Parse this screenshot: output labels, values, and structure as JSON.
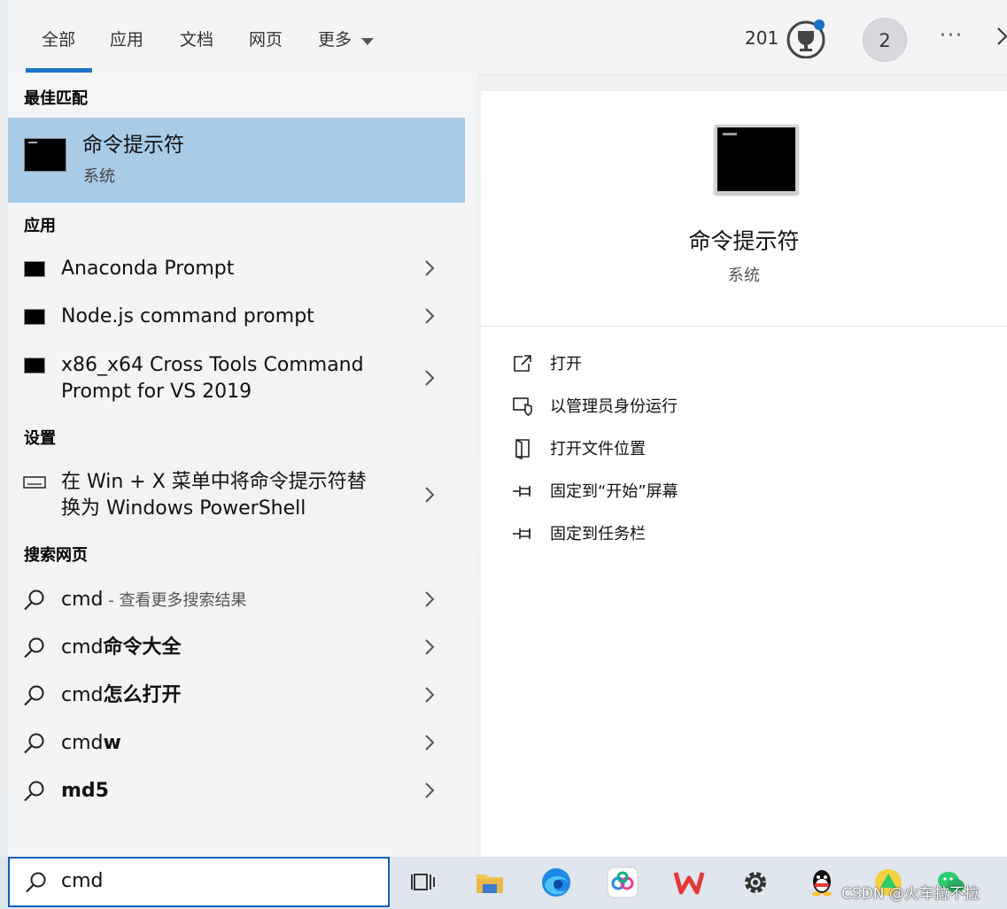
{
  "tabs": [
    {
      "label": "全部"
    },
    {
      "label": "应用"
    },
    {
      "label": "文档"
    },
    {
      "label": "网页"
    },
    {
      "label": "更多"
    }
  ],
  "topbar": {
    "reward_count": "201",
    "badge_number": "2",
    "more_dots": "···"
  },
  "best_match": {
    "section_title": "最佳匹配",
    "name": "命令提示符",
    "subtitle": "系统"
  },
  "apps": {
    "section_title": "应用",
    "items": [
      {
        "line1": "Anaconda Prompt",
        "line2": ""
      },
      {
        "line1": "Node.js command prompt",
        "line2": ""
      },
      {
        "line1": "x86_x64 Cross Tools Command",
        "line2": "Prompt for VS 2019"
      }
    ]
  },
  "settings": {
    "section_title": "设置",
    "items": [
      {
        "line1": "在 Win + X 菜单中将命令提示符替",
        "line2": "换为 Windows PowerShell"
      }
    ]
  },
  "web": {
    "section_title": "搜索网页",
    "items": [
      {
        "prefix": "cmd",
        "bold": "",
        "suffix": " - 查看更多搜索结果"
      },
      {
        "prefix": "cmd",
        "bold": "命令大全",
        "suffix": ""
      },
      {
        "prefix": "cmd",
        "bold": "怎么打开",
        "suffix": ""
      },
      {
        "prefix": "cmd",
        "bold": "w",
        "suffix": ""
      },
      {
        "prefix": "",
        "bold": "md5",
        "suffix": ""
      }
    ]
  },
  "detail": {
    "title": "命令提示符",
    "subtitle": "系统",
    "actions": [
      {
        "label": "打开",
        "icon": "open-icon"
      },
      {
        "label": "以管理员身份运行",
        "icon": "shield-icon"
      },
      {
        "label": "打开文件位置",
        "icon": "file-location-icon"
      },
      {
        "label": "固定到“开始”屏幕",
        "icon": "pin-icon"
      },
      {
        "label": "固定到任务栏",
        "icon": "pin-icon"
      }
    ]
  },
  "search": {
    "value": "cmd"
  },
  "taskbar": {
    "icons": [
      "task-view-icon",
      "file-explorer-icon",
      "edge-icon",
      "baidu-netdisk-icon",
      "wps-icon",
      "settings-icon",
      "qq-icon",
      "app-icon",
      "wechat-icon"
    ]
  },
  "watermark": "CSDN @火车拉不拉",
  "colors": {
    "accent": "#1a73c8",
    "selected_row": "#a8cbe8",
    "taskbar": "#dfe6ee"
  }
}
